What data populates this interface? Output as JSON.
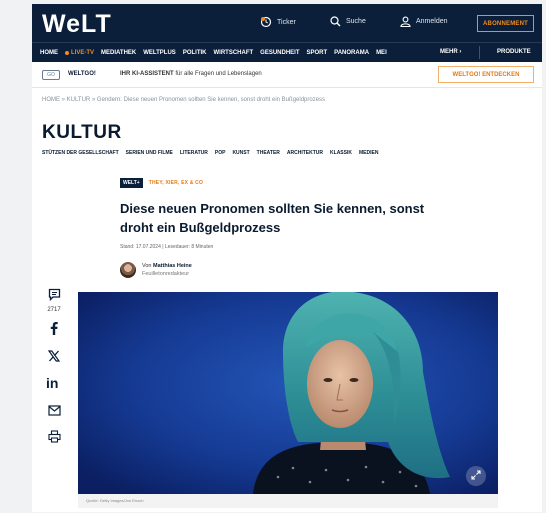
{
  "header": {
    "logo": "WeLT",
    "ticker_label": "Ticker",
    "search_label": "Suche",
    "login_label": "Anmelden",
    "subscribe_label": "ABONNEMENT"
  },
  "nav": {
    "items": [
      {
        "label": "HOME"
      },
      {
        "label": "LIVE-TV"
      },
      {
        "label": "MEDIATHEK"
      },
      {
        "label": "WELTPLUS"
      },
      {
        "label": "POLITIK"
      },
      {
        "label": "WIRTSCHAFT"
      },
      {
        "label": "GESUNDHEIT"
      },
      {
        "label": "SPORT"
      },
      {
        "label": "PANORAMA"
      },
      {
        "label": "MEI"
      }
    ],
    "more_label": "MEHR ›",
    "products_label": "PRODUKTE"
  },
  "weltgo": {
    "logo_text": "GO",
    "brand": "WELTGO!",
    "assistant_bold": "IHR KI-ASSISTENT",
    "assistant_text": "für alle Fragen und Lebenslagen",
    "cta_label": "WELTGO! ENTDECKEN"
  },
  "breadcrumb": "HOME  »  KULTUR  »  Gendern: Diese neuen Pronomen sollten Sie kennen, sonst droht ein Bußgeldprozess",
  "section": {
    "title": "KULTUR",
    "subnav": [
      "STÜTZEN DER GESELLSCHAFT",
      "SERIEN UND FILME",
      "LITERATUR",
      "POP",
      "KUNST",
      "THEATER",
      "ARCHITEKTUR",
      "KLASSIK",
      "MEDIEN"
    ]
  },
  "article": {
    "badge": "WELT+",
    "kicker": "THEY, XIER, EX & CO",
    "headline": "Diese neuen Pronomen sollten Sie kennen, sonst droht ein Bußgeldprozess",
    "meta": "Stand: 17.07.2024  |  Lesedauer: 8 Minuten",
    "author_prefix": "Von",
    "author_name": "Matthias Heine",
    "author_role": "Feuilletonredakteur",
    "caption": "Quelle: Getty Images/Jon Enoch"
  },
  "share": {
    "comment_count": "2717"
  },
  "colors": {
    "navy": "#0b1f3a",
    "orange": "#f28c1c",
    "hero_blue": "#14348a",
    "hair_teal": "#3fa6a8"
  }
}
